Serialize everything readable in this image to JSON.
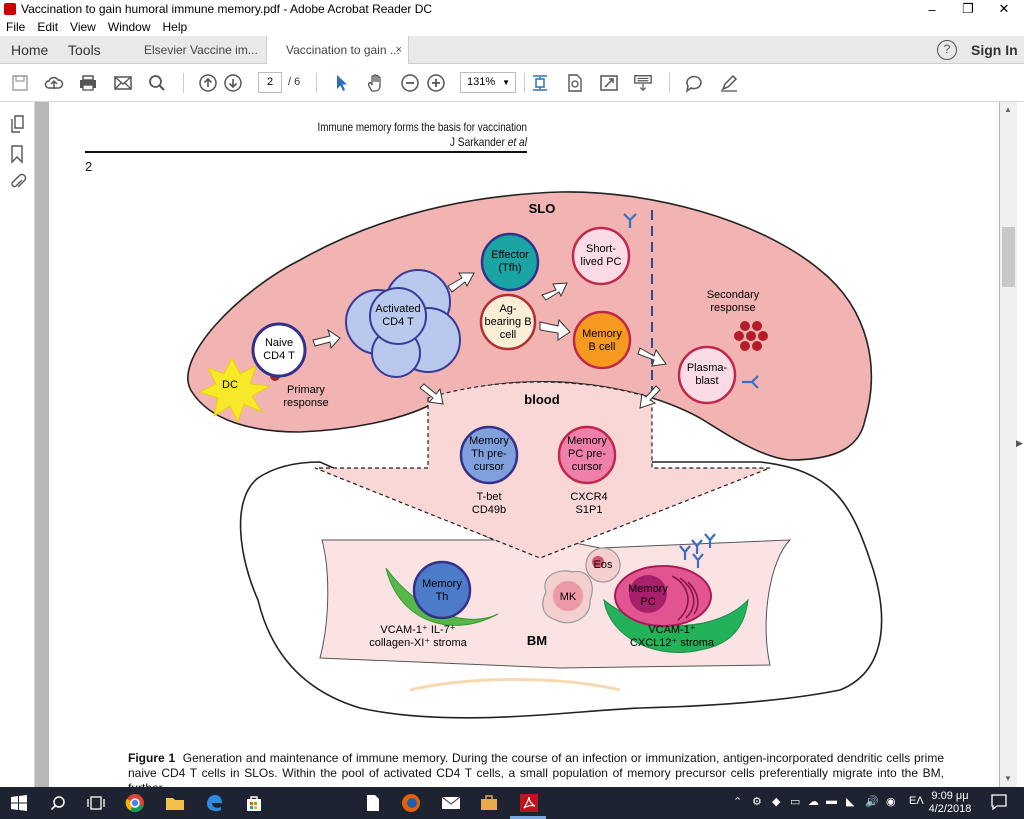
{
  "window": {
    "title": "Vaccination to gain humoral immune memory.pdf - Adobe Acrobat Reader DC",
    "minimize": "–",
    "restore": "❐",
    "close": "✕"
  },
  "menu": [
    "File",
    "Edit",
    "View",
    "Window",
    "Help"
  ],
  "tabs": {
    "home": "Home",
    "tools": "Tools",
    "doc_tabs": [
      {
        "label": "Elsevier Vaccine im..."
      },
      {
        "label": "Vaccination to gain ..."
      }
    ],
    "close_glyph": "×",
    "help_glyph": "?",
    "sign_in": "Sign In"
  },
  "toolbar": {
    "current_page": "2",
    "total_pages": "/ 6",
    "zoom": "131%",
    "zoom_arrow": "▼"
  },
  "page": {
    "header_title": "Immune memory forms the basis for vaccination",
    "header_author_name": "J Sarkander",
    "header_author_etal": "et al",
    "page_number": "2",
    "caption_label": "Figure 1",
    "caption_text": "Generation and maintenance of immune memory. During the course of an infection or immunization, antigen-incorporated dendritic cells prime naive CD4 T cells in SLOs. Within the pool of activated CD4 T cells, a small population of memory precursor cells preferentially migrate into the BM, further"
  },
  "figure": {
    "slo": "SLO",
    "blood": "blood",
    "bm": "BM",
    "dc": "DC",
    "naive": [
      "Naive",
      "CD4 T"
    ],
    "primary": [
      "Primary",
      "response"
    ],
    "activated": [
      "Activated",
      "CD4 T"
    ],
    "effector": [
      "Effector",
      "(Tfh)"
    ],
    "agb": [
      "Ag-",
      "bearing B",
      "cell"
    ],
    "shortlived": [
      "Short-",
      "lived PC"
    ],
    "memb": [
      "Memory",
      "B cell"
    ],
    "secondary": [
      "Secondary",
      "response"
    ],
    "plasmablast": [
      "Plasma-",
      "blast"
    ],
    "memth_pre": [
      "Memory",
      "Th pre-",
      "cursor"
    ],
    "mempc_pre": [
      "Memory",
      "PC pre-",
      "cursor"
    ],
    "tbet": [
      "T-bet",
      "CD49b"
    ],
    "cxcr4": [
      "CXCR4",
      "S1P1"
    ],
    "memth": [
      "Memory",
      "Th"
    ],
    "mk": "MK",
    "eos": "Eos",
    "mempc": [
      "Memory",
      "PC"
    ],
    "stroma_left": [
      "VCAM-1⁺ IL-7⁺",
      "collagen-XI⁺ stroma"
    ],
    "stroma_right": [
      "VCAM-1⁺",
      "CXCL12⁺ stroma"
    ]
  },
  "taskbar": {
    "time": "9:09 μμ",
    "date": "4/2/2018",
    "lang": "EΛ"
  },
  "colors": {
    "slo_fill": "#f2b3b3",
    "blood_fill": "#f9d7d7",
    "cell_blue": "#b9c9ee",
    "effector_teal": "#1aa4a4",
    "memory_orange": "#f59a1e",
    "memth_blue": "#4b7bc9",
    "pc_pink": "#e25590",
    "stroma_green": "#56b848"
  }
}
